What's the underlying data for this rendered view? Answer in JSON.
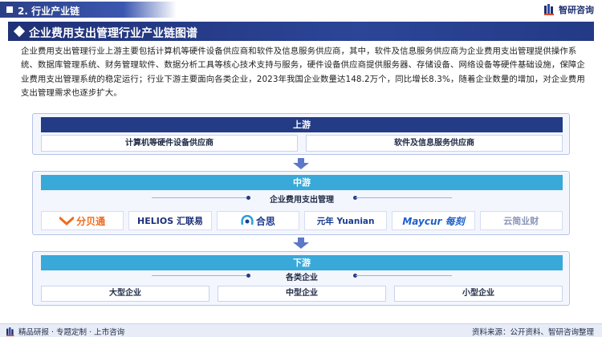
{
  "header": {
    "section_label": "2. 行业产业链",
    "brand_name": "智研咨询"
  },
  "title": "企业费用支出管理行业产业链图谱",
  "intro": "企业费用支出管理行业上游主要包括计算机等硬件设备供应商和软件及信息服务供应商，其中，软件及信息服务供应商为企业费用支出管理提供操作系统、数据库管理系统、财务管理软件、数据分析工具等核心技术支持与服务，硬件设备供应商提供服务器、存储设备、网络设备等硬件基础设施，保障企业费用支出管理系统的稳定运行；行业下游主要面向各类企业，2023年我国企业数量达148.2万个，同比增长8.3%，随着企业数量的增加，对企业费用支出管理需求也逐步扩大。",
  "upstream": {
    "label": "上游",
    "items": [
      "计算机等硬件设备供应商",
      "软件及信息服务供应商"
    ]
  },
  "midstream": {
    "label": "中游",
    "sub_label": "企业费用支出管理",
    "companies": [
      {
        "name": "分贝通",
        "color": "#f06a1d"
      },
      {
        "name": "HELIOS 汇联易",
        "color": "#1c2f7a"
      },
      {
        "name": "合思",
        "color": "#1f3b8f"
      },
      {
        "name": "元年 Yuanian",
        "color": "#1a3c8f"
      },
      {
        "name": "Maycur 每刻",
        "color": "#1e5fc9"
      },
      {
        "name": "云简业财",
        "color": "#8a96b8"
      }
    ]
  },
  "downstream": {
    "label": "下游",
    "sub_label": "各类企业",
    "items": [
      "大型企业",
      "中型企业",
      "小型企业"
    ]
  },
  "footer": {
    "left": "精品研报 · 专题定制 · 上市咨询",
    "right": "资料来源：公开资料、智研咨询整理"
  }
}
